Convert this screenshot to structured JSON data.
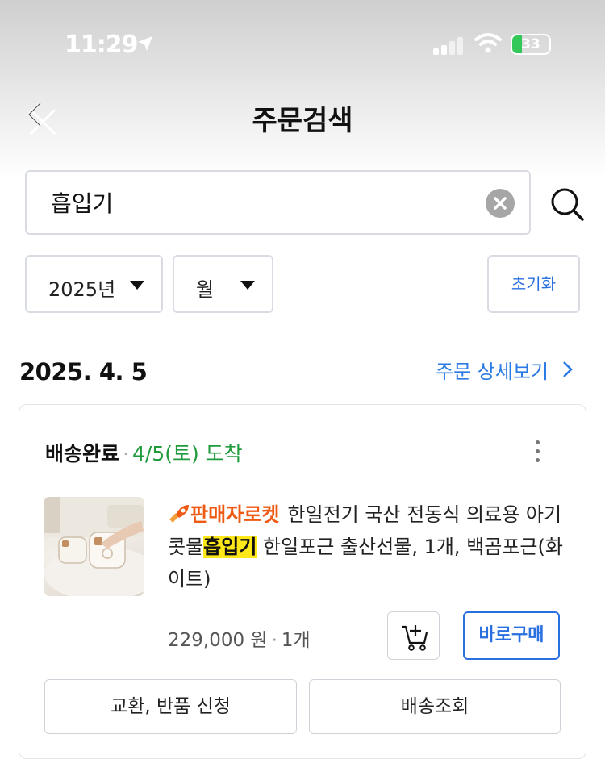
{
  "status_bar": {
    "time": "11:29",
    "battery": "33"
  },
  "header": {
    "title": "주문검색"
  },
  "search": {
    "value": "흡입기"
  },
  "filters": {
    "year": "2025년",
    "month": "월",
    "reset_label": "초기화"
  },
  "order": {
    "date": "2025. 4. 5",
    "detail_link": "주문 상세보기",
    "status": "배송완료",
    "arrival": "4/5(토) 도착",
    "product": {
      "badge": "판매자로켓",
      "title_before": "한일전기 국산 전동식 의료용 아기 콧물",
      "title_highlight": "흡입기",
      "title_after": " 한일포근 출산선물, 1개, 백곰포근(화이트)",
      "price": "229,000 원",
      "quantity": "1개"
    },
    "buy_now_label": "바로구매",
    "exchange_return_label": "교환, 반품 신청",
    "tracking_label": "배송조회"
  },
  "icons": {
    "back": "back-close-icon",
    "clear": "clear-icon",
    "search": "search-icon",
    "cart": "add-to-cart-icon",
    "more": "more-vertical-icon",
    "rocket": "rocket-icon"
  },
  "colors": {
    "accent_blue": "#2a6fe0",
    "link_blue": "#2a7ae4",
    "arrival_green": "#1f9a3c",
    "rocket_orange": "#ee5a14",
    "highlight_yellow": "#ffe81a"
  }
}
